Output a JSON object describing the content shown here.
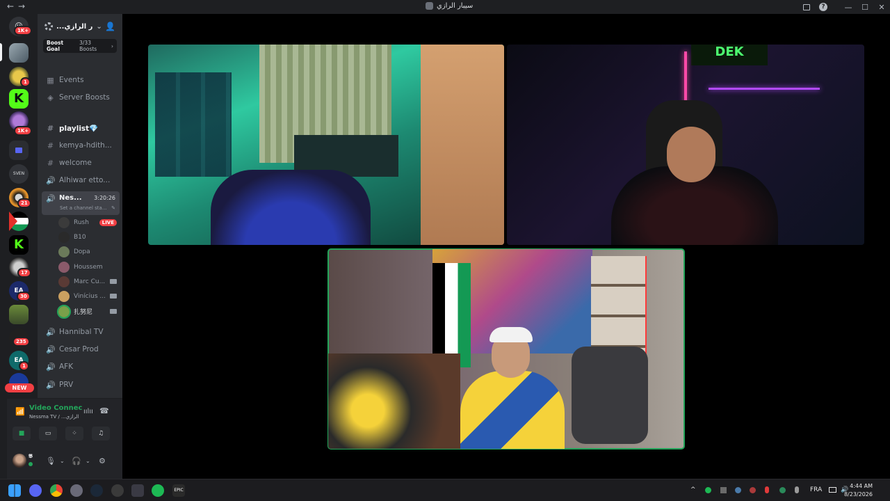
{
  "window": {
    "title": "سيبار الرازي",
    "nav_arrows": "←→",
    "controls": {
      "minimize": "—",
      "maximize": "☐",
      "close": "✕",
      "help": "?"
    }
  },
  "guild_rail": {
    "items": [
      {
        "name": "direct-messages",
        "badge": "1K+"
      },
      {
        "name": "server-active",
        "badge": ""
      },
      {
        "name": "server-a",
        "badge": "1"
      },
      {
        "name": "server-kick",
        "badge": ""
      },
      {
        "name": "server-b",
        "badge": "1K+"
      },
      {
        "name": "folder",
        "badge": ""
      },
      {
        "name": "server-sven",
        "badge": ""
      },
      {
        "name": "server-c",
        "badge": "21"
      },
      {
        "name": "server-palestine",
        "badge": ""
      },
      {
        "name": "server-kick-2",
        "badge": ""
      },
      {
        "name": "server-d",
        "badge": "17"
      },
      {
        "name": "server-ea",
        "badge": "30"
      },
      {
        "name": "server-e",
        "badge": ""
      },
      {
        "name": "server-f",
        "badge": "235"
      },
      {
        "name": "server-ea-2",
        "badge": "1"
      },
      {
        "name": "server-ea-3",
        "badge": ""
      }
    ],
    "new_label": "NEW"
  },
  "server": {
    "name": "...ر الرازي",
    "boost_goal_label": "Boost Goal",
    "boost_count": "3/33 Boosts"
  },
  "channels": {
    "events": "Events",
    "server_boosts": "Server Boosts",
    "list": [
      {
        "name": "playlist💎",
        "type": "text",
        "unread": true
      },
      {
        "name": "kemya-hdith...",
        "type": "text",
        "unread": false
      },
      {
        "name": "welcome",
        "type": "text",
        "unread": false
      },
      {
        "name": "Alhiwar etto...",
        "type": "voice",
        "unread": false
      }
    ],
    "active_voice": {
      "name": "Nes...",
      "timer": "3:20:26",
      "status_placeholder": "Set a channel sta...",
      "users": [
        {
          "name": "Rush",
          "live": true,
          "camera": false,
          "color": "#3b3b3b"
        },
        {
          "name": "B10",
          "live": false,
          "camera": false,
          "color": "#2a2a2a"
        },
        {
          "name": "Dopa",
          "live": false,
          "camera": false,
          "color": "#6b7a5a"
        },
        {
          "name": "Houssem",
          "live": false,
          "camera": false,
          "color": "#8a5a6a"
        },
        {
          "name": "Marc Cu...",
          "live": false,
          "camera": true,
          "color": "#5a3a35"
        },
        {
          "name": "Vinícius ...",
          "live": false,
          "camera": true,
          "color": "#caa060"
        },
        {
          "name": "扎努尼",
          "live": false,
          "camera": true,
          "color": "#7aa04a"
        }
      ],
      "live_label": "LIVE"
    },
    "after": [
      {
        "name": "Hannibal TV",
        "type": "voice"
      },
      {
        "name": "Cesar Prod",
        "type": "voice"
      },
      {
        "name": "AFK",
        "type": "voice"
      },
      {
        "name": "PRV",
        "type": "voice"
      }
    ]
  },
  "voice_connection": {
    "status": "Video Connec",
    "subtitle": "Nessma TV / ...الرازي"
  },
  "user": {
    "name": "𝕭",
    "status_dot": "#23a55a"
  },
  "video_tiles": [
    {
      "name": "tile-top-left",
      "speaking": false
    },
    {
      "name": "tile-top-right",
      "speaking": false
    },
    {
      "name": "tile-bottom",
      "speaking": true
    }
  ],
  "taskbar": {
    "language": "FRA",
    "time": "4:44 AM",
    "date": "8/23/2026",
    "tray_arrow": "^",
    "apps": [
      "start",
      "discord",
      "chrome",
      "settings",
      "steam",
      "epic-overlay",
      "apps-grid",
      "spotify",
      "epic-games"
    ]
  }
}
